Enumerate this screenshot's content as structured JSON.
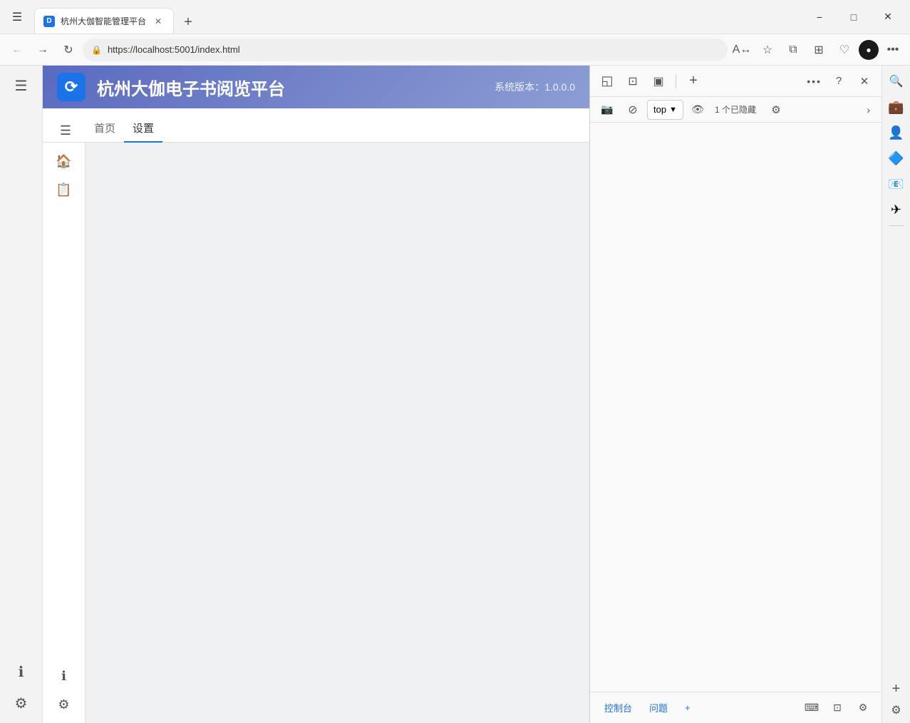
{
  "browser": {
    "tab_title": "杭州大伽智能管理平台",
    "tab_favicon": "D",
    "url": "https://localhost:5001/index.html",
    "window_controls": {
      "minimize": "−",
      "maximize": "□",
      "close": "✕"
    }
  },
  "toolbar": {
    "back": "←",
    "forward": "→",
    "refresh": "↻",
    "url": "https://localhost:5001/index.html",
    "translate": "A",
    "favorite": "☆",
    "collections": "⧉",
    "favorites_bar": "⊞",
    "browser_essentials": "♡",
    "profile_icon": "●",
    "more": "…"
  },
  "devtools": {
    "toolbar_buttons": [
      "inspect",
      "device",
      "elements",
      "add",
      "more",
      "help",
      "close"
    ],
    "toolbar_icons": [
      "◱",
      "⊡",
      "▣",
      "+",
      "•••",
      "?",
      "✕"
    ],
    "row2_buttons": [
      "screenshot",
      "block",
      "context_select",
      "dots",
      "eye",
      "hidden_count",
      "settings"
    ],
    "context_label": "top",
    "hidden_count": "1 个已隐藏",
    "expand_arrow": "›",
    "bottom_buttons": [
      "控制台",
      "问题",
      "+"
    ],
    "bottom_icons": [
      "⌨",
      "⊡",
      "⚙"
    ]
  },
  "app": {
    "logo": "⟳",
    "title": "杭州大伽电子书阅览平台",
    "version": "系统版本：1.0.0.0",
    "nav_items": [
      "首页",
      "设置"
    ],
    "active_nav": "设置",
    "sidebar_icons": [
      "🏠",
      "📋"
    ],
    "bottom_sidebar_icons": [
      "ℹ",
      "⚙"
    ]
  },
  "extensions": {
    "icons": [
      "🔍",
      "💼",
      "👤",
      "🔷",
      "📧",
      "✈"
    ],
    "add_label": "+",
    "settings_label": "⚙"
  }
}
